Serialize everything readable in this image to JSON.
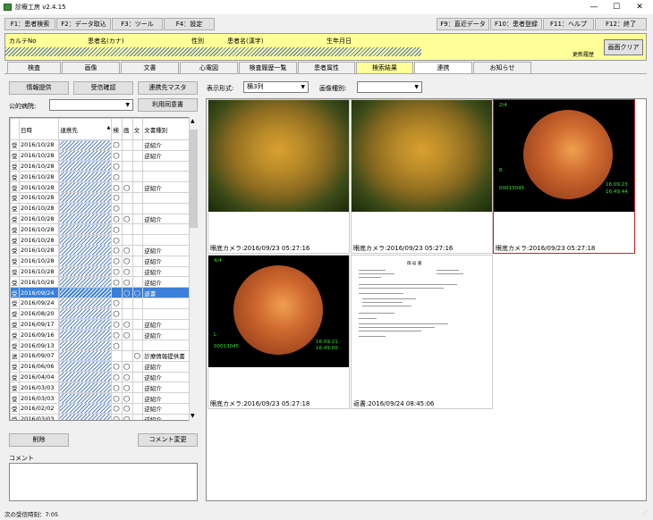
{
  "window": {
    "title": "診療工房 v2.4.15"
  },
  "fkeys": [
    "F1：患者検索",
    "F2：データ取込",
    "F3：ツール",
    "F4：設定",
    "F9：直近データ",
    "F10：患者登録",
    "F11：ヘルプ",
    "F12：終了"
  ],
  "patient": {
    "kartno_label": "カルテNo",
    "kana_label": "患者名(カナ)",
    "sex_label": "性別",
    "kanji_label": "患者名(漢字)",
    "dob_label": "生年月日",
    "history_label": "更新履歴",
    "clear_label": "画面クリア"
  },
  "tabs": [
    "検査",
    "画像",
    "文書",
    "心電図",
    "検査履歴一覧",
    "患者属性",
    "検索結果",
    "連携",
    "お知らせ"
  ],
  "left": {
    "btn_info": "情報提供",
    "btn_recv": "受信確認",
    "btn_master": "連携先マスタ",
    "hospital_label": "公的病院:",
    "hospital_value": "",
    "consent_btn": "利用同意書",
    "headers": {
      "date": "日時",
      "partner": "連携先",
      "sort": "▲",
      "ken": "検",
      "ga": "画",
      "bun": "文",
      "doc_type": "文書種別"
    },
    "delete_btn": "削除",
    "comment_change_btn": "コメント変更",
    "comment_label": "コメント"
  },
  "rows": [
    {
      "kind": "受",
      "date": "2016/10/28",
      "ken": "◯",
      "ga": "",
      "bun": "",
      "type": "逆紹介"
    },
    {
      "kind": "受",
      "date": "2016/10/28",
      "ken": "◯",
      "ga": "",
      "bun": "",
      "type": "逆紹介"
    },
    {
      "kind": "受",
      "date": "2016/10/28",
      "ken": "◯",
      "ga": "",
      "bun": "",
      "type": ""
    },
    {
      "kind": "受",
      "date": "2016/10/28",
      "ken": "◯",
      "ga": "",
      "bun": "",
      "type": ""
    },
    {
      "kind": "受",
      "date": "2016/10/28",
      "ken": "◯",
      "ga": "◯",
      "bun": "",
      "type": "逆紹介"
    },
    {
      "kind": "受",
      "date": "2016/10/28",
      "ken": "◯",
      "ga": "",
      "bun": "",
      "type": ""
    },
    {
      "kind": "受",
      "date": "2016/10/28",
      "ken": "◯",
      "ga": "",
      "bun": "",
      "type": ""
    },
    {
      "kind": "受",
      "date": "2016/10/28",
      "ken": "◯",
      "ga": "◯",
      "bun": "",
      "type": "逆紹介"
    },
    {
      "kind": "受",
      "date": "2016/10/28",
      "ken": "◯",
      "ga": "",
      "bun": "",
      "type": ""
    },
    {
      "kind": "受",
      "date": "2016/10/28",
      "ken": "◯",
      "ga": "",
      "bun": "",
      "type": ""
    },
    {
      "kind": "受",
      "date": "2016/10/28",
      "ken": "◯",
      "ga": "◯",
      "bun": "",
      "type": "逆紹介"
    },
    {
      "kind": "受",
      "date": "2016/10/28",
      "ken": "◯",
      "ga": "◯",
      "bun": "",
      "type": "逆紹介"
    },
    {
      "kind": "受",
      "date": "2016/10/28",
      "ken": "◯",
      "ga": "◯",
      "bun": "",
      "type": "逆紹介"
    },
    {
      "kind": "受",
      "date": "2016/10/28",
      "ken": "◯",
      "ga": "◯",
      "bun": "",
      "type": "逆紹介"
    },
    {
      "kind": "受",
      "date": "2016/09/24",
      "ken": "",
      "ga": "◯",
      "bun": "◯",
      "type": "返書",
      "selected": true
    },
    {
      "kind": "受",
      "date": "2016/09/24",
      "ken": "◯",
      "ga": "",
      "bun": "",
      "type": ""
    },
    {
      "kind": "受",
      "date": "2016/08/20",
      "ken": "◯",
      "ga": "",
      "bun": "",
      "type": ""
    },
    {
      "kind": "受",
      "date": "2016/09/17",
      "ken": "◯",
      "ga": "◯",
      "bun": "",
      "type": "逆紹介"
    },
    {
      "kind": "受",
      "date": "2016/09/16",
      "ken": "◯",
      "ga": "◯",
      "bun": "",
      "type": "逆紹介"
    },
    {
      "kind": "受",
      "date": "2016/09/13",
      "ken": "◯",
      "ga": "",
      "bun": "",
      "type": ""
    },
    {
      "kind": "送",
      "date": "2016/09/07",
      "ken": "",
      "ga": "",
      "bun": "◯",
      "type": "診療情報提供書"
    },
    {
      "kind": "受",
      "date": "2016/06/06",
      "ken": "◯",
      "ga": "◯",
      "bun": "",
      "type": "逆紹介"
    },
    {
      "kind": "受",
      "date": "2016/04/04",
      "ken": "◯",
      "ga": "◯",
      "bun": "",
      "type": "逆紹介"
    },
    {
      "kind": "受",
      "date": "2016/03/03",
      "ken": "◯",
      "ga": "◯",
      "bun": "",
      "type": "逆紹介"
    },
    {
      "kind": "受",
      "date": "2016/03/03",
      "ken": "◯",
      "ga": "◯",
      "bun": "",
      "type": "逆紹介"
    },
    {
      "kind": "受",
      "date": "2016/02/02",
      "ken": "◯",
      "ga": "◯",
      "bun": "",
      "type": "逆紹介"
    },
    {
      "kind": "受",
      "date": "2016/03/03",
      "ken": "◯",
      "ga": "◯",
      "bun": "",
      "type": "逆紹介"
    }
  ],
  "right": {
    "display_label": "表示形式:",
    "display_value": "横3列",
    "imgtype_label": "画像種別:",
    "imgtype_value": ""
  },
  "images": [
    {
      "caption": "眼底カメラ:2016/09/23 05:27:16",
      "kind": "wide"
    },
    {
      "caption": "眼底カメラ:2016/09/23 05:27:16",
      "kind": "wide"
    },
    {
      "caption": "眼底カメラ:2016/09/23 05:27:18",
      "kind": "fundus",
      "tl": "2/4",
      "r": "R",
      "id": "00013045",
      "t1": "16:09:23",
      "t2": "16:49:44"
    },
    {
      "caption": "眼底カメラ:2016/09/23 05:27:18",
      "kind": "fundus",
      "tl": "4/4",
      "r": "L",
      "id": "00013045",
      "t1": "16:09:21",
      "t2": "16:49:00"
    },
    {
      "caption": "返書:2016/09/24 08:45:06",
      "kind": "doc",
      "doc_title": "御 返 書"
    }
  ],
  "status": {
    "text": "次の受信時刻：7:05"
  }
}
